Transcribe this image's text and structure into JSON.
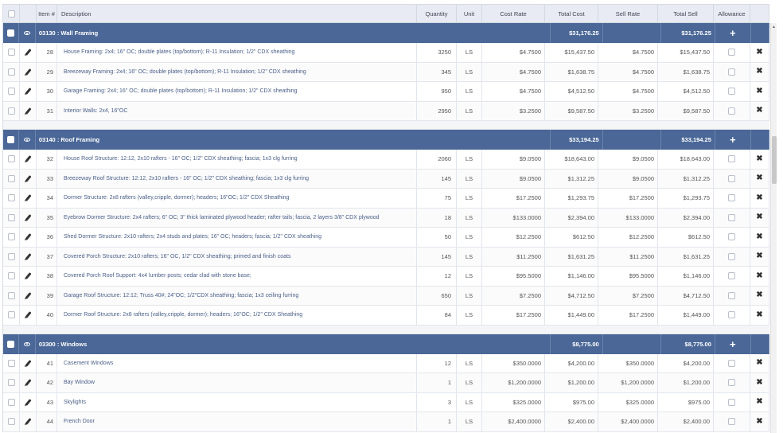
{
  "header": {
    "item": "Item #",
    "description": "Description",
    "quantity": "Quantity",
    "unit": "Unit",
    "cost_rate": "Cost Rate",
    "total_cost": "Total Cost",
    "sell_rate": "Sell Rate",
    "total_sell": "Total Sell",
    "allowance": "Allowance"
  },
  "groups": [
    {
      "label": "03130 : Wall Framing",
      "total_cost": "$31,176.25",
      "total_sell": "$31,176.25",
      "items": [
        {
          "num": "28",
          "desc": "House Framing: 2x4; 16\" OC; double plates (top/bottom); R-11 Insulation; 1/2\" CDX sheathing",
          "qty": "3250",
          "unit": "LS",
          "cost_rate": "$4.7500",
          "total_cost": "$15,437.50",
          "sell_rate": "$4.7500",
          "total_sell": "$15,437.50"
        },
        {
          "num": "29",
          "desc": "Breezeway Framing: 2x4; 16\" OC; double plates (top/bottom); R-11 Insulation; 1/2\" CDX sheathing",
          "qty": "345",
          "unit": "LS",
          "cost_rate": "$4.7500",
          "total_cost": "$1,638.75",
          "sell_rate": "$4.7500",
          "total_sell": "$1,638.75"
        },
        {
          "num": "30",
          "desc": "Garage Framing: 2x4; 16\" OC; double plates (top/bottom); R-11 Insulation; 1/2\" CDX sheathing",
          "qty": "950",
          "unit": "LS",
          "cost_rate": "$4.7500",
          "total_cost": "$4,512.50",
          "sell_rate": "$4.7500",
          "total_sell": "$4,512.50"
        },
        {
          "num": "31",
          "desc": "Interior Walls: 2x4, 16\"OC",
          "qty": "2950",
          "unit": "LS",
          "cost_rate": "$3.2500",
          "total_cost": "$9,587.50",
          "sell_rate": "$3.2500",
          "total_sell": "$9,587.50"
        }
      ]
    },
    {
      "label": "03140 : Roof Framing",
      "total_cost": "$33,194.25",
      "total_sell": "$33,194.25",
      "items": [
        {
          "num": "32",
          "desc": "House Roof Structure: 12:12, 2x10 rafters - 16\" OC; 1/2\" CDX sheathing; fascia; 1x3 clg furring",
          "qty": "2060",
          "unit": "LS",
          "cost_rate": "$9.0500",
          "total_cost": "$18,643.00",
          "sell_rate": "$9.0500",
          "total_sell": "$18,643.00"
        },
        {
          "num": "33",
          "desc": "Breezeway Roof Structure: 12:12, 2x10 rafters - 16\" OC; 1/2\" CDX sheathing; fascia; 1x3 clg furring",
          "qty": "145",
          "unit": "LS",
          "cost_rate": "$9.0500",
          "total_cost": "$1,312.25",
          "sell_rate": "$9.0500",
          "total_sell": "$1,312.25"
        },
        {
          "num": "34",
          "desc": "Dormer Structure: 2x8 rafters (valley,cripple, dormer); headers; 16\"OC; 1/2\" CDX Sheathing",
          "qty": "75",
          "unit": "LS",
          "cost_rate": "$17.2500",
          "total_cost": "$1,293.75",
          "sell_rate": "$17.2500",
          "total_sell": "$1,293.75"
        },
        {
          "num": "35",
          "desc": "Eyebrow Dormer Structure: 2x4 rafters; 6\" OC; 3\" thick laminated plywood header; rafter tails; fascia, 2 layers 3/8\" CDX plywood",
          "qty": "18",
          "unit": "LS",
          "cost_rate": "$133.0000",
          "total_cost": "$2,394.00",
          "sell_rate": "$133.0000",
          "total_sell": "$2,394.00"
        },
        {
          "num": "36",
          "desc": "Shed Dormer Structure: 2x10 rafters; 2x4 studs and plates; 16\" OC; headers; fascia; 1/2\" CDX sheathing",
          "qty": "50",
          "unit": "LS",
          "cost_rate": "$12.2500",
          "total_cost": "$612.50",
          "sell_rate": "$12.2500",
          "total_sell": "$612.50"
        },
        {
          "num": "37",
          "desc": "Covered Porch Structure: 2x10 rafters; 16\" OC, 1/2\" CDX sheathing; primed and finish coats",
          "qty": "145",
          "unit": "LS",
          "cost_rate": "$11.2500",
          "total_cost": "$1,631.25",
          "sell_rate": "$11.2500",
          "total_sell": "$1,631.25"
        },
        {
          "num": "38",
          "desc": "Covered Porch Roof Support: 4x4 lumber posts; cedar clad with stone base;",
          "qty": "12",
          "unit": "LS",
          "cost_rate": "$95.5000",
          "total_cost": "$1,146.00",
          "sell_rate": "$95.5000",
          "total_sell": "$1,146.00"
        },
        {
          "num": "39",
          "desc": "Garage Roof Structure: 12:12; Truss 40#; 24\"OC; 1/2\"CDX sheathing; fascia; 1x3 ceiling furring",
          "qty": "650",
          "unit": "LS",
          "cost_rate": "$7.2500",
          "total_cost": "$4,712.50",
          "sell_rate": "$7.2500",
          "total_sell": "$4,712.50"
        },
        {
          "num": "40",
          "desc": "Dormer Roof Structure: 2x8 rafters (valley,cripple, dormer); headers; 16\"OC; 1/2\" CDX Sheathing",
          "qty": "84",
          "unit": "LS",
          "cost_rate": "$17.2500",
          "total_cost": "$1,449.00",
          "sell_rate": "$17.2500",
          "total_sell": "$1,449.00"
        }
      ]
    },
    {
      "label": "03300 : Windows",
      "total_cost": "$8,775.00",
      "total_sell": "$8,775.00",
      "items": [
        {
          "num": "41",
          "desc": "Casement Windows",
          "qty": "12",
          "unit": "LS",
          "cost_rate": "$350.0000",
          "total_cost": "$4,200.00",
          "sell_rate": "$350.0000",
          "total_sell": "$4,200.00"
        },
        {
          "num": "42",
          "desc": "Bay Window",
          "qty": "1",
          "unit": "LS",
          "cost_rate": "$1,200.0000",
          "total_cost": "$1,200.00",
          "sell_rate": "$1,200.0000",
          "total_sell": "$1,200.00"
        },
        {
          "num": "43",
          "desc": "Skylights",
          "qty": "3",
          "unit": "LS",
          "cost_rate": "$325.0000",
          "total_cost": "$975.00",
          "sell_rate": "$325.0000",
          "total_sell": "$975.00"
        },
        {
          "num": "44",
          "desc": "French Door",
          "qty": "1",
          "unit": "LS",
          "cost_rate": "$2,400.0000",
          "total_cost": "$2,400.00",
          "sell_rate": "$2,400.0000",
          "total_sell": "$2,400.00"
        }
      ]
    }
  ],
  "icons": {
    "eye": "eye-icon",
    "edit": "pencil-icon",
    "add": "plus-icon",
    "delete": "close-icon"
  },
  "colors": {
    "group_header_bg": "#4a6797",
    "header_bg": "#e8ebf3",
    "link_text": "#4a5f86"
  }
}
